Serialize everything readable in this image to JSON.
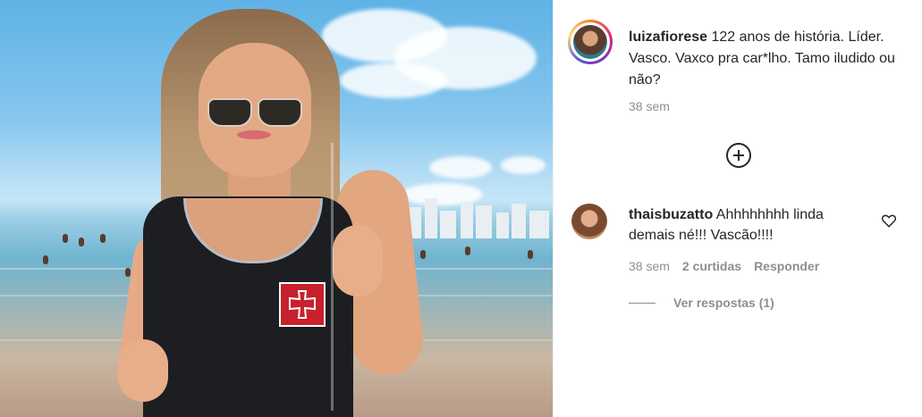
{
  "post": {
    "username": "luizafiorese",
    "caption": "122 anos de história. Líder. Vasco. Vaxco pra car*lho. Tamo iludido ou não?",
    "time": "38 sem"
  },
  "comment": {
    "username": "thaisbuzatto",
    "text": "Ahhhhhhhh linda demais né!!! Vascão!!!!",
    "time": "38 sem",
    "likes": "2 curtidas",
    "reply_label": "Responder",
    "view_replies": "Ver respostas (1)"
  },
  "colors": {
    "text": "#262626",
    "secondary": "#8e8e8e",
    "emblem": "#c8202c"
  }
}
